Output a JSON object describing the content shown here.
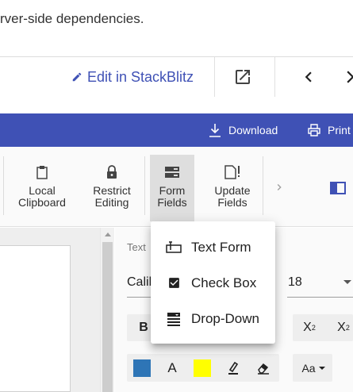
{
  "intro": {
    "text": "rver-side dependencies."
  },
  "demo_toolbar": {
    "edit_link": "Edit in StackBlitz",
    "icons": [
      "open-in-new-icon",
      "chevron-left-icon",
      "close-icon"
    ]
  },
  "app_bar": {
    "color": "#3f51b5",
    "download_label": "Download",
    "print_label": "Print"
  },
  "ribbon": {
    "items": [
      {
        "label_line1": "Local",
        "label_line2": "Clipboard",
        "icon": "clipboard-icon"
      },
      {
        "label_line1": "Restrict",
        "label_line2": "Editing",
        "icon": "lock-icon"
      },
      {
        "label_line1": "Form",
        "label_line2": "Fields",
        "icon": "form-fields-icon",
        "active": true
      },
      {
        "label_line1": "Update",
        "label_line2": "Fields",
        "icon": "update-fields-icon"
      }
    ]
  },
  "form_fields_menu": {
    "items": [
      {
        "label": "Text Form",
        "icon": "text-form-icon"
      },
      {
        "label": "Check Box",
        "icon": "check-box-icon"
      },
      {
        "label": "Drop-Down",
        "icon": "drop-down-icon"
      }
    ]
  },
  "properties_pane": {
    "title": "Text",
    "font_name": "Calib",
    "font_size": "18",
    "bold_label": "B",
    "superscript_base": "X",
    "superscript_mark": "2",
    "subscript_base": "X",
    "subscript_mark": "2",
    "font_color_label": "A",
    "change_case_label": "Aa",
    "swatch_blue": "#2e75b6",
    "swatch_yellow": "#ffff00"
  }
}
